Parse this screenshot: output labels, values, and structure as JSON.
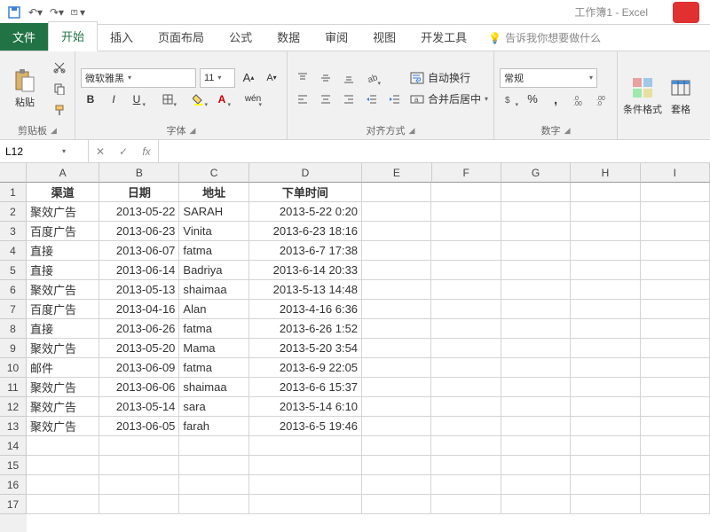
{
  "window": {
    "title": "工作簿1 - Excel"
  },
  "qat": {
    "save": "save",
    "undo": "undo",
    "redo": "redo",
    "customize": "customize"
  },
  "tabs": {
    "file": "文件",
    "home": "开始",
    "insert": "插入",
    "layout": "页面布局",
    "formulas": "公式",
    "data": "数据",
    "review": "审阅",
    "view": "视图",
    "developer": "开发工具",
    "tellme_icon": "💡",
    "tellme": "告诉我你想要做什么"
  },
  "ribbon": {
    "clipboard": {
      "paste": "粘贴",
      "label": "剪贴板"
    },
    "font": {
      "name": "微软雅黑",
      "size": "11",
      "bold": "B",
      "italic": "I",
      "underline": "U",
      "label": "字体",
      "phonetic": "wén"
    },
    "align": {
      "wrap": "自动换行",
      "merge": "合并后居中",
      "label": "对齐方式"
    },
    "number": {
      "format": "常规",
      "label": "数字"
    },
    "styles": {
      "condfmt": "条件格式",
      "tablefmt": "套格"
    }
  },
  "formula_bar": {
    "cell_ref": "L12",
    "cancel": "✕",
    "enter": "✓",
    "fx": "fx"
  },
  "grid": {
    "col_letters": [
      "A",
      "B",
      "C",
      "D",
      "E",
      "F",
      "G",
      "H",
      "I"
    ],
    "row_numbers": [
      "1",
      "2",
      "3",
      "4",
      "5",
      "6",
      "7",
      "8",
      "9",
      "10",
      "11",
      "12",
      "13",
      "14",
      "15",
      "16",
      "17"
    ],
    "headers": {
      "A": "渠道",
      "B": "日期",
      "C": "地址",
      "D": "下单时间"
    },
    "rows": [
      {
        "A": "聚效广告",
        "B": "2013-05-22",
        "C": "SARAH",
        "D": "2013-5-22 0:20"
      },
      {
        "A": "百度广告",
        "B": "2013-06-23",
        "C": "Vinita",
        "D": "2013-6-23 18:16"
      },
      {
        "A": "直接",
        "B": "2013-06-07",
        "C": "fatma",
        "D": "2013-6-7 17:38"
      },
      {
        "A": "直接",
        "B": "2013-06-14",
        "C": "Badriya",
        "D": "2013-6-14 20:33"
      },
      {
        "A": "聚效广告",
        "B": "2013-05-13",
        "C": "shaimaa",
        "D": "2013-5-13 14:48"
      },
      {
        "A": "百度广告",
        "B": "2013-04-16",
        "C": "Alan",
        "D": "2013-4-16 6:36"
      },
      {
        "A": "直接",
        "B": "2013-06-26",
        "C": "fatma",
        "D": "2013-6-26 1:52"
      },
      {
        "A": "聚效广告",
        "B": "2013-05-20",
        "C": "Mama",
        "D": "2013-5-20 3:54"
      },
      {
        "A": "邮件",
        "B": "2013-06-09",
        "C": "fatma",
        "D": "2013-6-9 22:05"
      },
      {
        "A": "聚效广告",
        "B": "2013-06-06",
        "C": "shaimaa",
        "D": "2013-6-6 15:37"
      },
      {
        "A": "聚效广告",
        "B": "2013-05-14",
        "C": "sara",
        "D": "2013-5-14 6:10"
      },
      {
        "A": "聚效广告",
        "B": "2013-06-05",
        "C": "farah",
        "D": "2013-6-5 19:46"
      }
    ]
  }
}
